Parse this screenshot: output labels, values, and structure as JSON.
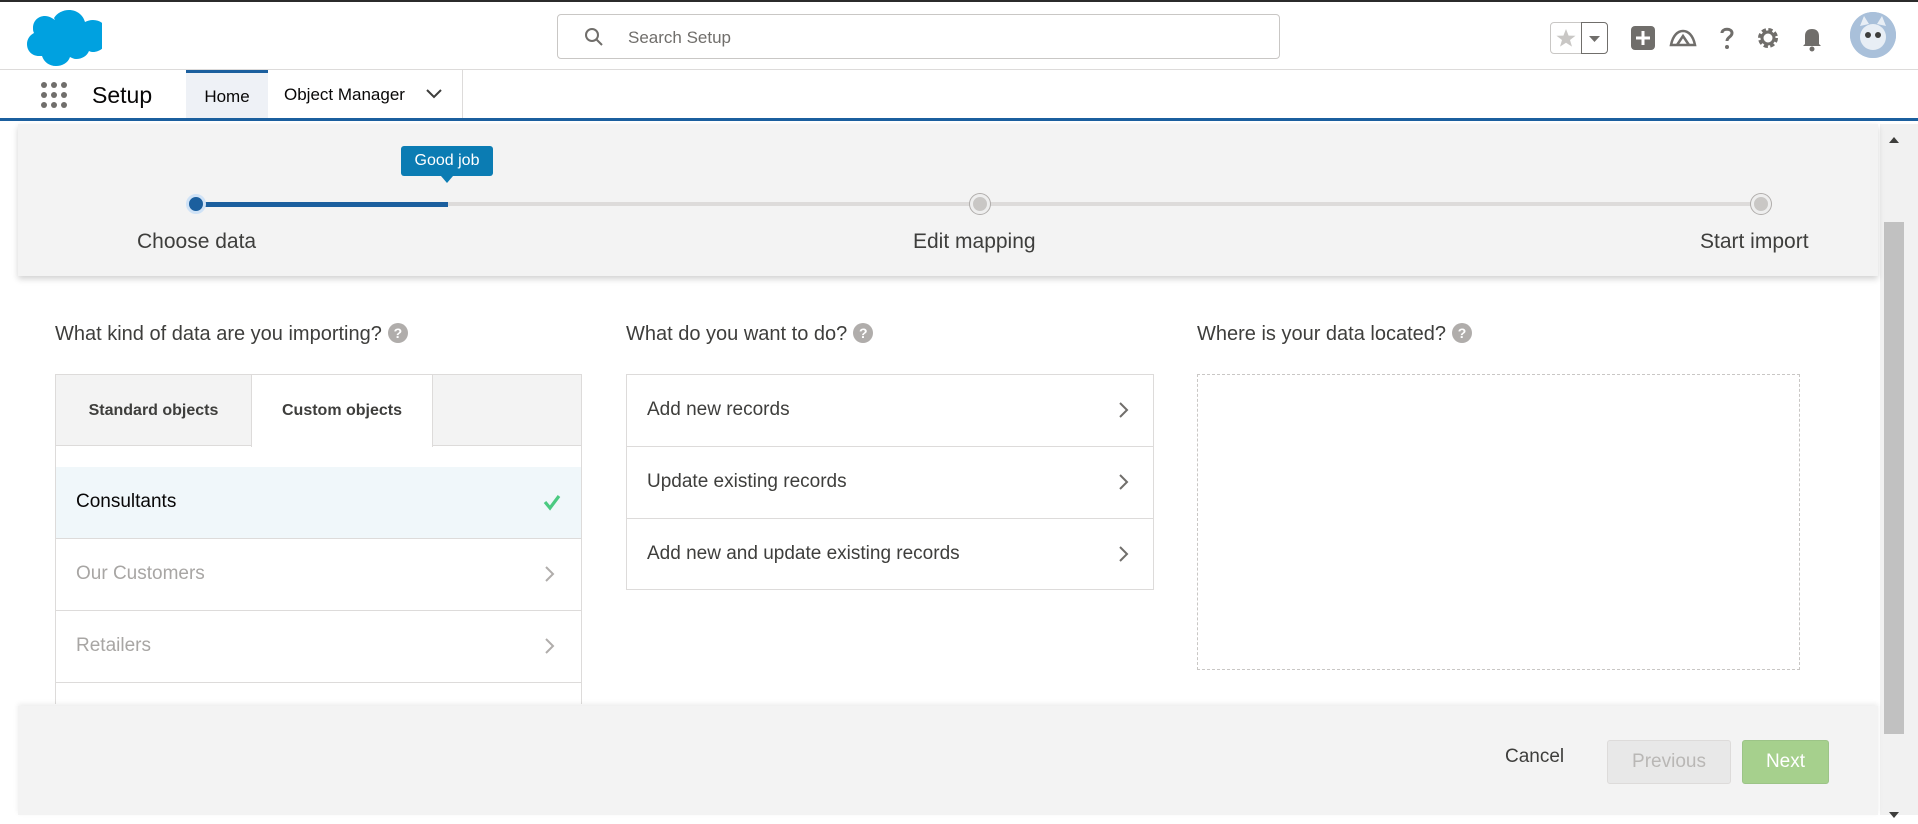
{
  "header": {
    "search_placeholder": "Search Setup",
    "brand_color": "#00a1e0",
    "icons": [
      "star-icon",
      "chevron-down-icon",
      "add-icon",
      "trailhead-icon",
      "help-icon",
      "gear-icon",
      "bell-icon",
      "avatar"
    ]
  },
  "nav": {
    "app_name": "Setup",
    "tabs": [
      {
        "label": "Home",
        "active": true
      },
      {
        "label": "Object Manager",
        "active": false
      }
    ]
  },
  "progress": {
    "tooltip": "Good job",
    "current_step": 1,
    "fill_fraction": 0.16,
    "steps": [
      {
        "label": "Choose data"
      },
      {
        "label": "Edit mapping"
      },
      {
        "label": "Start import"
      }
    ]
  },
  "columns": {
    "data_kind": {
      "title": "What kind of data are you importing?",
      "tabs": [
        {
          "label": "Standard objects",
          "active": false
        },
        {
          "label": "Custom objects",
          "active": true
        }
      ],
      "items": [
        {
          "label": "Consultants",
          "selected": true
        },
        {
          "label": "Our Customers",
          "selected": false
        },
        {
          "label": "Retailers",
          "selected": false
        }
      ]
    },
    "action": {
      "title": "What do you want to do?",
      "items": [
        {
          "label": "Add new records"
        },
        {
          "label": "Update existing records"
        },
        {
          "label": "Add new and update existing records"
        }
      ]
    },
    "location": {
      "title": "Where is your data located?"
    }
  },
  "footer": {
    "cancel": "Cancel",
    "previous": "Previous",
    "next": "Next"
  },
  "colors": {
    "accent": "#1b5f9e",
    "tooltip": "#0b7cb3",
    "success": "#4bca81",
    "next_button": "#a6d08d"
  }
}
